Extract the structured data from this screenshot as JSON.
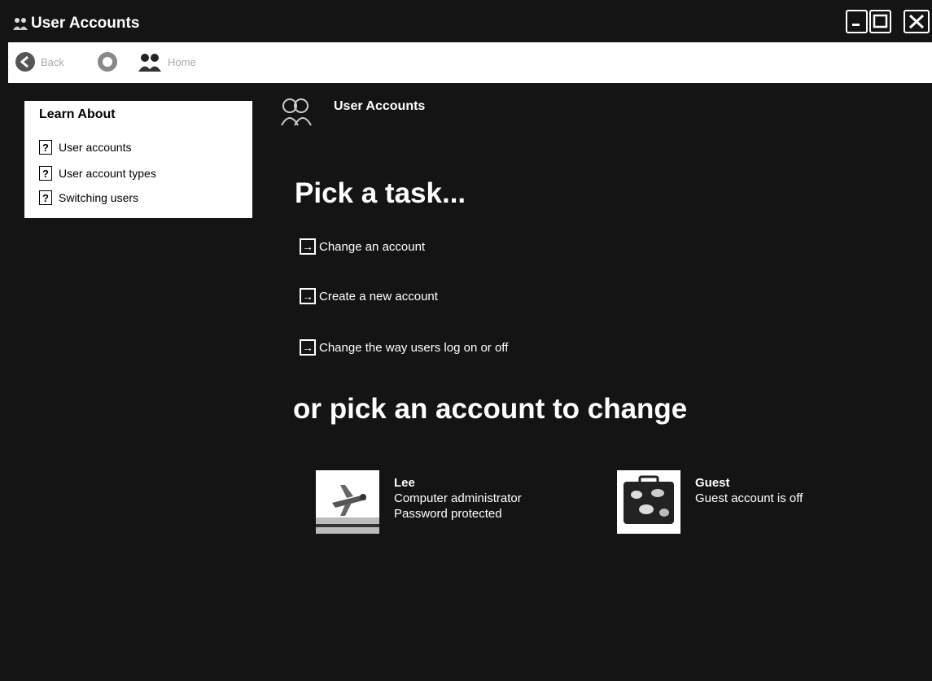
{
  "window": {
    "title": "User Accounts"
  },
  "toolbar": {
    "back_label": "Back",
    "home_label": "Home"
  },
  "learn_about": {
    "title": "Learn About",
    "items": [
      {
        "label": "User accounts"
      },
      {
        "label": "User account types"
      },
      {
        "label": "Switching users"
      }
    ]
  },
  "content": {
    "title": "User Accounts",
    "pick_task_heading": "Pick a task...",
    "tasks": [
      {
        "label": "Change an account"
      },
      {
        "label": "Create a new account"
      },
      {
        "label": "Change the way users log on or off"
      }
    ],
    "pick_account_heading": "or pick an account to change",
    "accounts": [
      {
        "name": "Lee",
        "details": [
          "Computer administrator",
          "Password protected"
        ],
        "picture": "airplane-picture"
      },
      {
        "name": "Guest",
        "details": [
          "Guest account is off"
        ],
        "picture": "suitcase-picture"
      }
    ]
  },
  "icons": [
    "users-icon",
    "back-arrow-icon",
    "forward-arrow-icon",
    "home-icon",
    "help-icon",
    "task-arrow-icon",
    "minimize-icon",
    "maximize-icon",
    "close-icon"
  ],
  "colors": {
    "background": "#141414",
    "text": "#ffffff",
    "panel": "#ffffff"
  }
}
